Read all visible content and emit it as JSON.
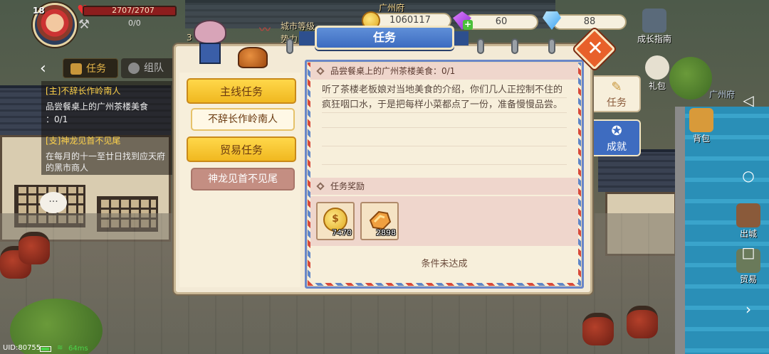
{
  "player": {
    "level": "18",
    "hp_text": "2707/2707",
    "mp_text": "0/0"
  },
  "scene": {
    "city_name": "广州府",
    "city_level_label": "城市等级",
    "power_label": "势力",
    "floor_label": "3",
    "location_label": "广州府"
  },
  "resources": {
    "gold": "1060117",
    "gems": "60",
    "diamonds": "88"
  },
  "left_panel": {
    "tab_quest": "任务",
    "tab_team": "组队",
    "quests": [
      {
        "title": "[主]不辞长作岭南人",
        "desc": "品尝餐桌上的广州茶楼美食",
        "progress": "：0/1"
      },
      {
        "title": "[支]神龙见首不见尾",
        "desc": "在每月的十一至廿日找到应天府的黑市商人"
      }
    ]
  },
  "dialog": {
    "title": "任务",
    "categories": {
      "main": "主线任务",
      "main_item": "不辞长作岭南人",
      "trade": "贸易任务",
      "trade_item": "神龙见首不见尾"
    },
    "quest_header": "品尝餐桌上的广州茶楼美食：0/1",
    "quest_desc": "听了茶楼老板娘对当地美食的介绍，你们几人正控制不住的疯狂咽口水，于是把每样小菜都点了一份，准备慢慢品尝。",
    "reward_header": "任务奖励",
    "rewards": [
      {
        "icon": "gold-coin-icon",
        "amount": "7470"
      },
      {
        "icon": "experience-icon",
        "amount": "2898"
      }
    ],
    "status": "条件未达成"
  },
  "side_tabs": {
    "task": "任务",
    "achievement": "成就"
  },
  "right_buttons": {
    "growth_guide": "成长指南",
    "gift": "礼包",
    "bag": "背包",
    "exit": "出城",
    "trade": "贸易"
  },
  "status_bar": {
    "uid": "UID:80755",
    "ping": "64ms"
  }
}
